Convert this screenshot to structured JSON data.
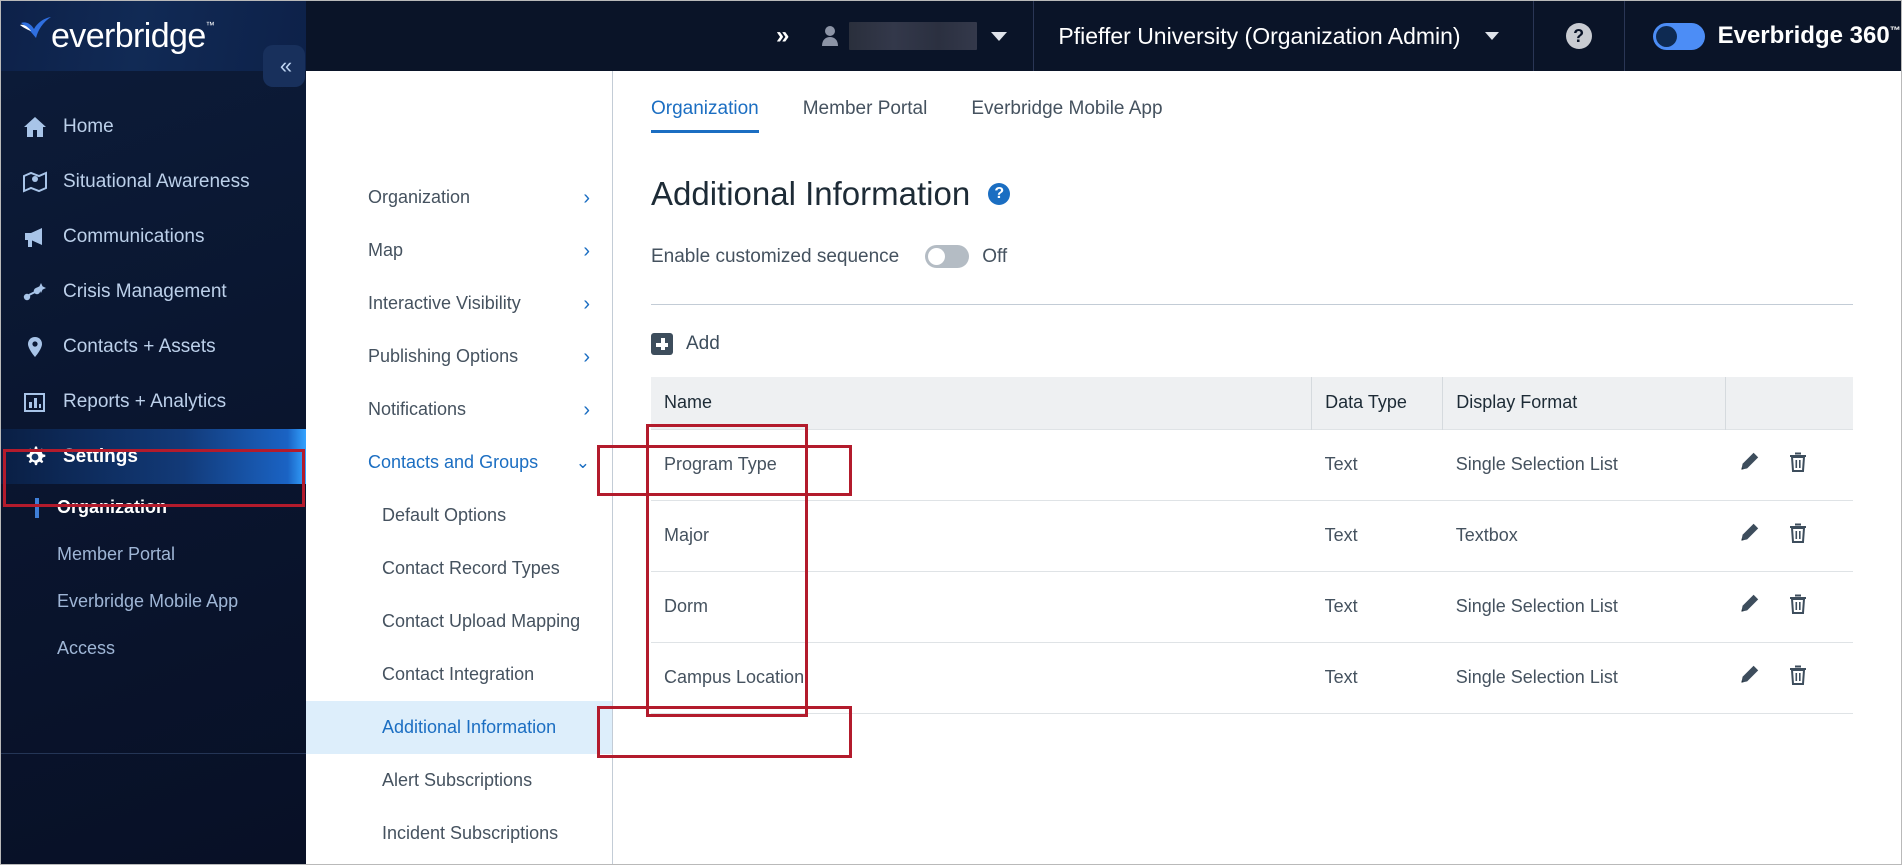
{
  "header": {
    "logo_text": "everbridge",
    "logo_tm": "™",
    "expand_icon": "chevron-double-right-icon",
    "user_icon": "person-icon",
    "user_name_redacted": "",
    "user_caret_icon": "caret-down-icon",
    "organization": "Pfieffer University (Organization Admin)",
    "org_caret_icon": "caret-down-icon",
    "help_label": "?",
    "brand_toggle_on": true,
    "brand_name": "Everbridge 360",
    "brand_tm": "™",
    "chat_icon": "chat-bubble-icon",
    "collapse_icon": "chevron-double-left-icon"
  },
  "sidebar": {
    "items": [
      {
        "label": "Home",
        "icon": "home-icon",
        "active": false
      },
      {
        "label": "Situational Awareness",
        "icon": "map-pin-icon",
        "active": false
      },
      {
        "label": "Communications",
        "icon": "megaphone-icon",
        "active": false
      },
      {
        "label": "Crisis Management",
        "icon": "crisis-network-icon",
        "active": false
      },
      {
        "label": "Contacts + Assets",
        "icon": "location-pin-icon",
        "active": false
      },
      {
        "label": "Reports + Analytics",
        "icon": "bar-chart-icon",
        "active": false
      },
      {
        "label": "Settings",
        "icon": "gear-icon",
        "active": true
      }
    ],
    "sub_items": [
      {
        "label": "Organization",
        "selected": true
      },
      {
        "label": "Member Portal",
        "selected": false
      },
      {
        "label": "Everbridge Mobile App",
        "selected": false
      },
      {
        "label": "Access",
        "selected": false
      }
    ]
  },
  "subnav": {
    "groups": [
      {
        "label": "Organization",
        "state": "collapsed",
        "icon": "chevron-right-icon"
      },
      {
        "label": "Map",
        "state": "collapsed",
        "icon": "chevron-right-icon"
      },
      {
        "label": "Interactive Visibility",
        "state": "collapsed",
        "icon": "chevron-right-icon"
      },
      {
        "label": "Publishing Options",
        "state": "collapsed",
        "icon": "chevron-right-icon"
      },
      {
        "label": "Notifications",
        "state": "collapsed",
        "icon": "chevron-right-icon"
      },
      {
        "label": "Contacts and Groups",
        "state": "expanded",
        "icon": "chevron-down-icon"
      }
    ],
    "children": [
      {
        "label": "Default Options",
        "selected": false
      },
      {
        "label": "Contact Record Types",
        "selected": false
      },
      {
        "label": "Contact Upload Mapping",
        "selected": false
      },
      {
        "label": "Contact Integration",
        "selected": false
      },
      {
        "label": "Additional Information",
        "selected": true
      },
      {
        "label": "Alert Subscriptions",
        "selected": false
      },
      {
        "label": "Incident Subscriptions",
        "selected": false
      }
    ]
  },
  "main": {
    "tabs": [
      {
        "label": "Organization",
        "active": true
      },
      {
        "label": "Member Portal",
        "active": false
      },
      {
        "label": "Everbridge Mobile App",
        "active": false
      }
    ],
    "page_title": "Additional Information",
    "title_help_icon": "help-circle-icon",
    "title_help_label": "?",
    "sequence_label": "Enable customized sequence",
    "sequence_state": "Off",
    "sequence_enabled": false,
    "add_label": "Add",
    "add_icon": "plus-square-icon",
    "table": {
      "columns": [
        "Name",
        "Data Type",
        "Display Format",
        ""
      ],
      "rows": [
        {
          "name": "Program Type",
          "data_type": "Text",
          "display_format": "Single Selection List",
          "edit_icon": "pencil-icon",
          "delete_icon": "trash-icon"
        },
        {
          "name": "Major",
          "data_type": "Text",
          "display_format": "Textbox",
          "edit_icon": "pencil-icon",
          "delete_icon": "trash-icon"
        },
        {
          "name": "Dorm",
          "data_type": "Text",
          "display_format": "Single Selection List",
          "edit_icon": "pencil-icon",
          "delete_icon": "trash-icon"
        },
        {
          "name": "Campus Location",
          "data_type": "Text",
          "display_format": "Single Selection List",
          "edit_icon": "pencil-icon",
          "delete_icon": "trash-icon"
        }
      ]
    }
  },
  "annotations": {
    "color": "#b31b2c",
    "boxes": [
      "settings-nav-item",
      "contacts-and-groups-group",
      "additional-information-child",
      "name-column"
    ]
  }
}
